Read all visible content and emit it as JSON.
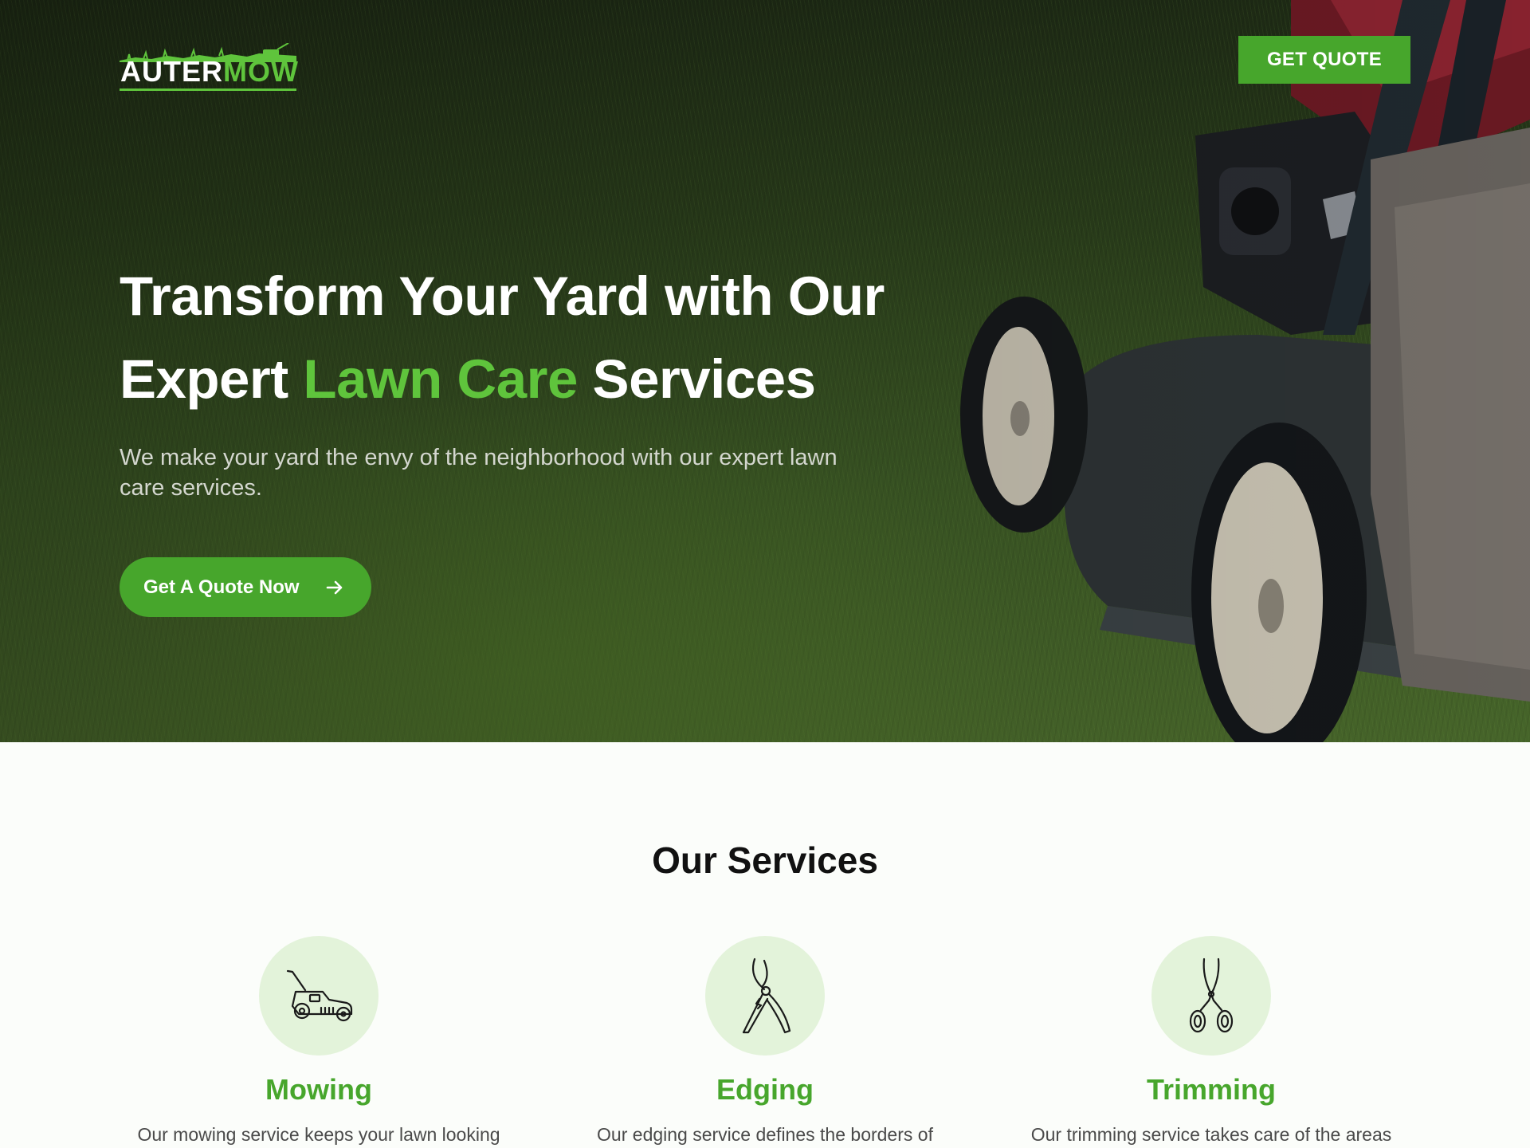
{
  "brand": {
    "logo_part1": "AUTER",
    "logo_part2": "MOW",
    "accent_color": "#47a62c",
    "accent_light": "#5fc43c"
  },
  "header": {
    "quote_button": "GET QUOTE"
  },
  "hero": {
    "title_line1": "Transform Your Yard with Our",
    "title_line2_pre": "Expert ",
    "title_line2_accent": "Lawn Care",
    "title_line2_post": " Services",
    "subtitle": "We make your yard the envy of the neighborhood with our expert lawn care services.",
    "cta_label": "Get A Quote Now",
    "cta_icon": "arrow-right-icon"
  },
  "services": {
    "title": "Our Services",
    "items": [
      {
        "name": "Mowing",
        "icon": "lawn-mower-icon",
        "desc": "Our mowing service keeps your lawn looking"
      },
      {
        "name": "Edging",
        "icon": "pruning-shears-icon",
        "desc": "Our edging service defines the borders of"
      },
      {
        "name": "Trimming",
        "icon": "scissors-icon",
        "desc": "Our trimming service takes care of the areas"
      }
    ]
  }
}
